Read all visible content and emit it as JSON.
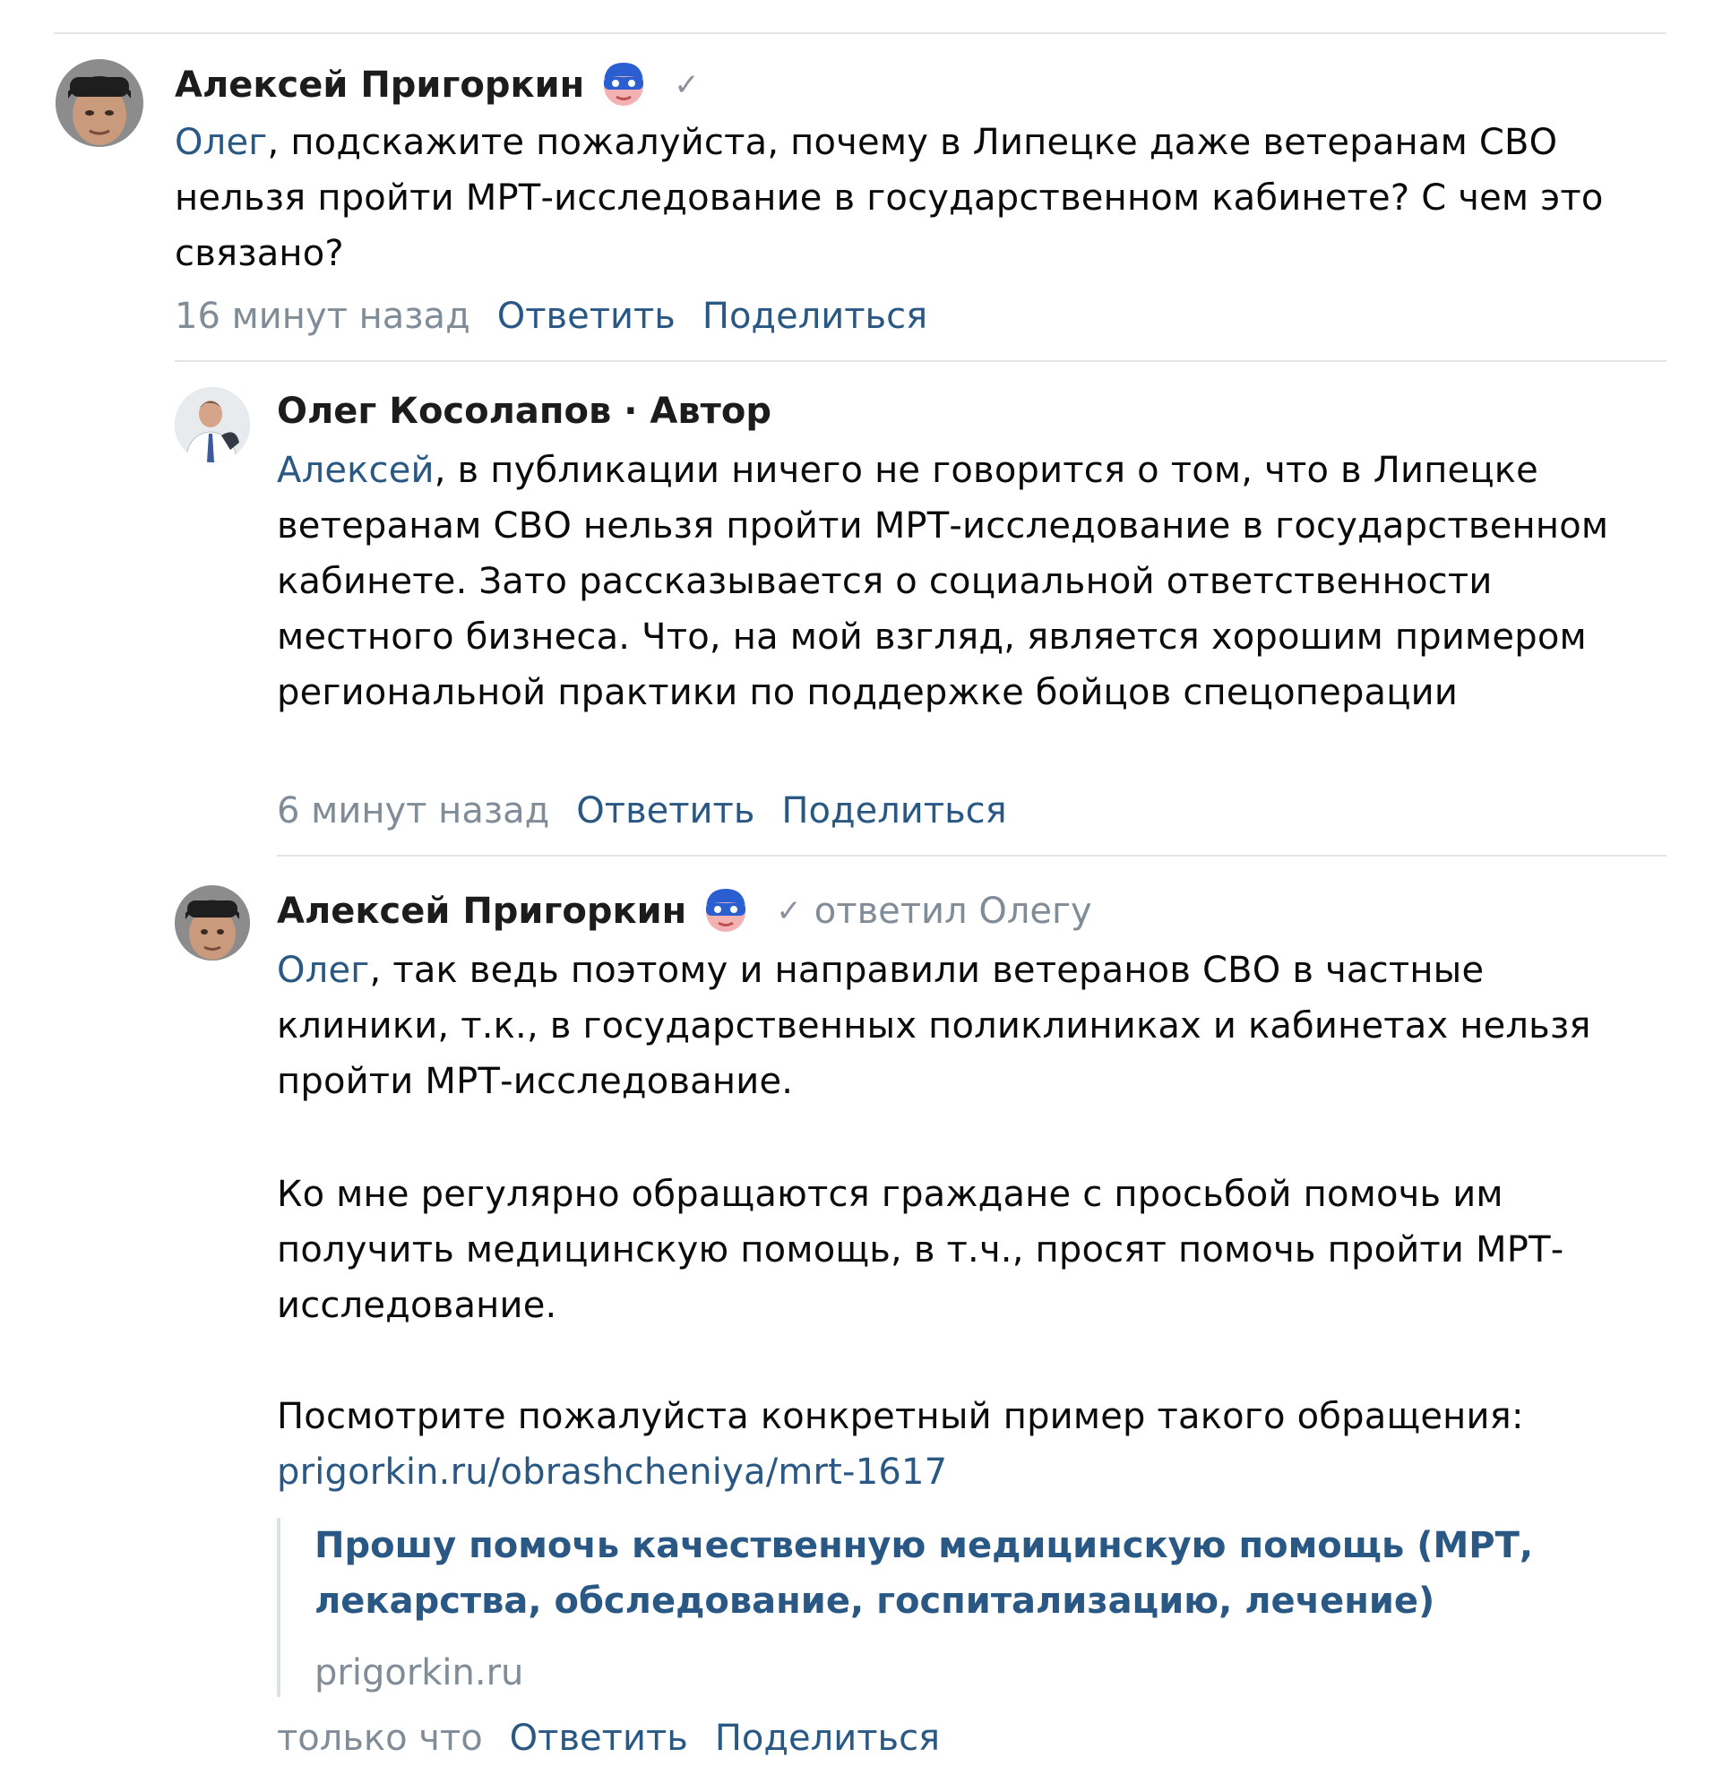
{
  "comments": [
    {
      "author": "Алексей Пригоркин",
      "verified": "✓",
      "mention": "Олег",
      "text": ", подскажите пожалуйста, почему в Липецке даже ветеранам СВО нельзя пройти МРТ-исследование в государственном кабинете? С чем это связано?",
      "time": "16 минут назад",
      "reply_label": "Ответить",
      "share_label": "Поделиться"
    },
    {
      "author": "Олег Косолапов · Автор",
      "mention": "Алексей",
      "text": ", в публикации ничего не говорится о том, что в Липецке ветеранам СВО нельзя пройти МРТ-исследование в государственном кабинете. Зато рассказывается о социальной ответственности местного бизнеса. Что, на мой взгляд, является хорошим примером региональной практики по поддержке бойцов спецоперации",
      "time": "6 минут назад",
      "reply_label": "Ответить",
      "share_label": "Поделиться"
    },
    {
      "author": "Алексей Пригоркин",
      "verified": "✓",
      "replied_to": "ответил Олегу",
      "mention": "Олег",
      "text": ", так ведь поэтому и направили ветеранов СВО в частные клиники, т.к., в государственных поликлиниках и кабинетах нельзя пройти МРТ-исследование.",
      "paragraph2": "Ко мне регулярно обращаются граждане с просьбой помочь им получить медицинскую помощь, в т.ч., просят помочь пройти МРТ-исследование.",
      "paragraph3": "Посмотрите пожалуйста конкретный пример такого обращения:",
      "link": "prigorkin.ru/obrashcheniya/mrt-1617",
      "snippet_title": "Прошу помочь качественную медицинскую помощь (МРТ, лекарства, обследование, госпитализацию, лечение)",
      "snippet_domain": "prigorkin.ru",
      "time": "только что",
      "reply_label": "Ответить",
      "share_label": "Поделиться"
    }
  ],
  "colors": {
    "link": "#2a5885",
    "meta": "#818c99",
    "divider": "#e3e5e8"
  }
}
